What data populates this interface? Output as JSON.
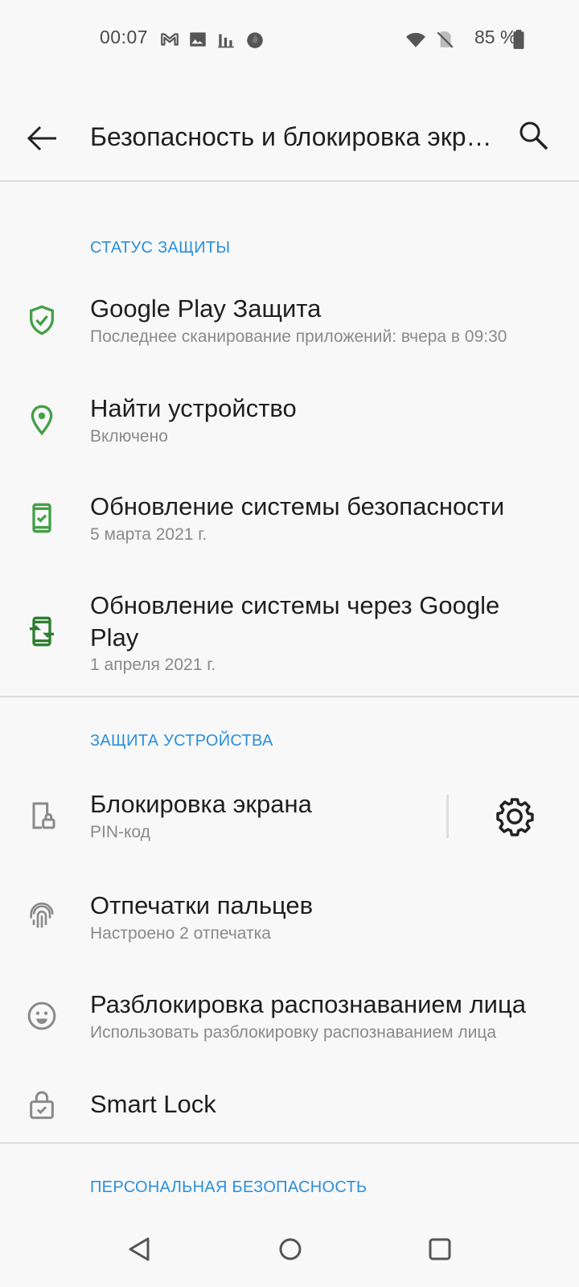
{
  "status_bar": {
    "time": "00:07",
    "battery_percent": "85 %",
    "icons": [
      "gmail-icon",
      "gallery-icon",
      "stats-icon",
      "fire-icon",
      "wifi-icon",
      "no-sim-icon",
      "battery-icon"
    ]
  },
  "app_bar": {
    "title": "Безопасность и блокировка экрана",
    "back_icon": "arrow-left-icon",
    "search_icon": "search-icon"
  },
  "sections": {
    "protection_status": {
      "header": "СТАТУС ЗАЩИТЫ",
      "items": [
        {
          "title": "Google Play Защита",
          "subtitle": "Последнее сканирование приложений: вчера в 09:30",
          "icon": "shield-check-icon"
        },
        {
          "title": "Найти устройство",
          "subtitle": "Включено",
          "icon": "location-pin-icon"
        },
        {
          "title": "Обновление системы безопасности",
          "subtitle": "5 марта 2021 г.",
          "icon": "phone-check-icon"
        },
        {
          "title": "Обновление системы через Google Play",
          "subtitle": "1 апреля 2021 г.",
          "icon": "phone-sync-icon"
        }
      ]
    },
    "device_protection": {
      "header": "ЗАЩИТА УСТРОЙСТВА",
      "items": [
        {
          "title": "Блокировка экрана",
          "subtitle": "PIN-код",
          "icon": "phone-lock-icon"
        },
        {
          "title": "Отпечатки пальцев",
          "subtitle": "Настроено 2 отпечатка",
          "icon": "fingerprint-icon"
        },
        {
          "title": "Разблокировка распознаванием лица",
          "subtitle": "Использовать разблокировку распознаванием лица",
          "icon": "face-icon"
        },
        {
          "title": "Smart Lock",
          "icon": "lock-check-icon"
        }
      ]
    },
    "personal_security": {
      "header": "ПЕРСОНАЛЬНАЯ БЕЗОПАСНОСТЬ"
    }
  },
  "colors": {
    "accent": "#2c8fdb",
    "icon_green": "#43a047",
    "background": "#f8f8f8"
  },
  "nav_bar": {
    "icons": [
      "back-triangle-icon",
      "home-circle-icon",
      "recents-square-icon"
    ]
  }
}
